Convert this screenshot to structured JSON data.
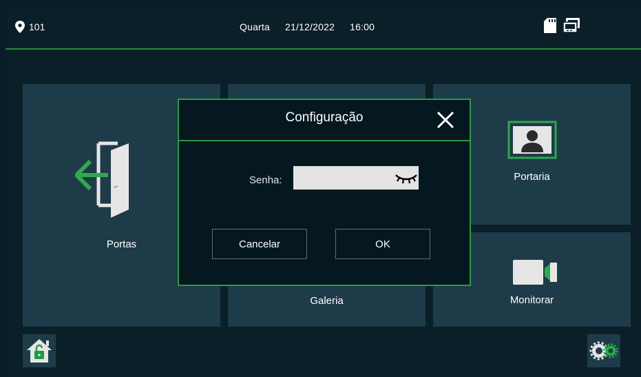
{
  "status_bar": {
    "location_icon": "location-pin-icon",
    "unit": "101",
    "day": "Quarta",
    "date": "21/12/2022",
    "time": "16:00",
    "sd_card_icon": "sd-card-icon",
    "intercom_icon": "intercom-device-icon"
  },
  "tiles": {
    "portas": {
      "label": "Portas",
      "icon": "door-exit-icon"
    },
    "galeria": {
      "label": "Galeria"
    },
    "portaria": {
      "label": "Portaria",
      "icon": "reception-contact-icon"
    },
    "monitorar": {
      "label": "Monitorar",
      "icon": "video-camera-icon"
    }
  },
  "dialog": {
    "title": "Configuração",
    "password_label": "Senha:",
    "password_value": "",
    "cancel_label": "Cancelar",
    "ok_label": "OK",
    "close_icon": "close-icon",
    "eye_icon": "eye-closed-icon"
  },
  "corner_buttons": {
    "left_icon": "home-unlock-icon",
    "right_icon": "settings-gears-icon"
  },
  "colors": {
    "accent": "#2e9a44",
    "tile": "#1e3b49",
    "background": "#0b1f29"
  }
}
